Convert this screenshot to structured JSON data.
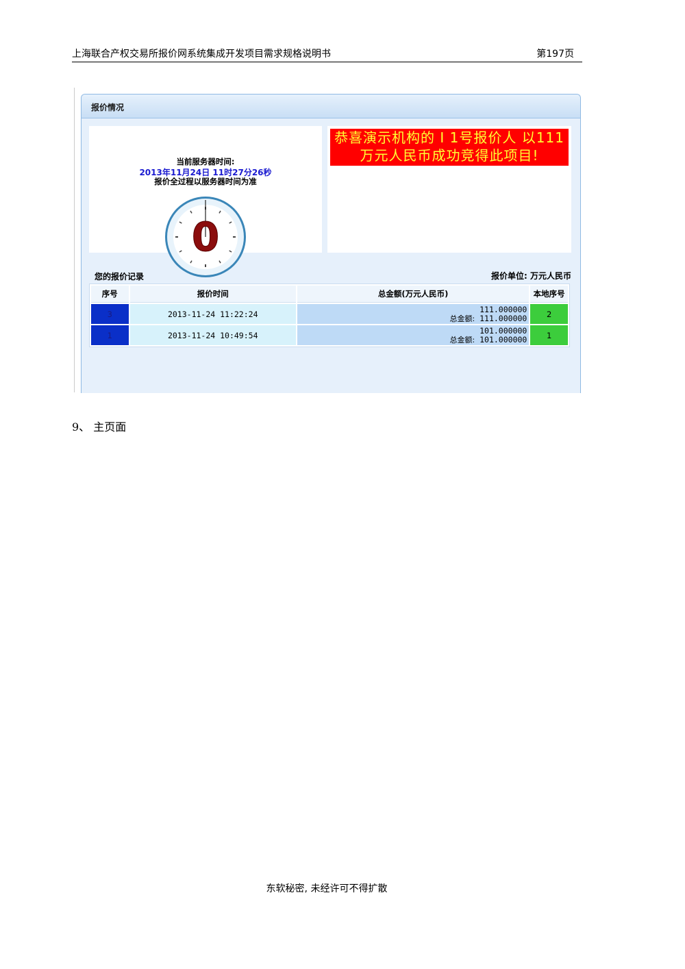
{
  "header": {
    "title": "上海联合产权交易所报价网系统集成开发项目需求规格说明书",
    "page": "第197页"
  },
  "panel": {
    "title": "报价情况",
    "server_label": "当前服务器时间:",
    "server_time": "2013年11月24日  11时27分26秒",
    "server_note": "报价全过程以服务器时间为准",
    "countdown": "0",
    "banner_line1": "恭喜演示机构的 I 1号报价人 以111",
    "banner_line2": "万元人民币成功竞得此项目!",
    "records_title": "您的报价记录",
    "unit_label": "报价单位: 万元人民币",
    "table": {
      "headers": [
        "序号",
        "报价时间",
        "总金额(万元人民币)",
        "本地序号"
      ],
      "rows": [
        {
          "seq": "3",
          "time": "2013-11-24 11:22:24",
          "amount": "111.000000",
          "total_label": "总金额:",
          "total": "111.000000",
          "local": "2"
        },
        {
          "seq": "1",
          "time": "2013-11-24 10:49:54",
          "amount": "101.000000",
          "total_label": "总金额:",
          "total": "101.000000",
          "local": "1"
        }
      ]
    }
  },
  "section": {
    "title": "9、 主页面"
  },
  "footer": {
    "text": "东软秘密, 未经许可不得扩散"
  },
  "colors": {
    "banner_bg": "#ff0000",
    "banner_text": "#ffff33",
    "seq_bg": "#0a2fc8",
    "local_bg": "#3ccd3c",
    "clock_ring": "#3a86b8",
    "countdown": "#8b0d0d"
  }
}
